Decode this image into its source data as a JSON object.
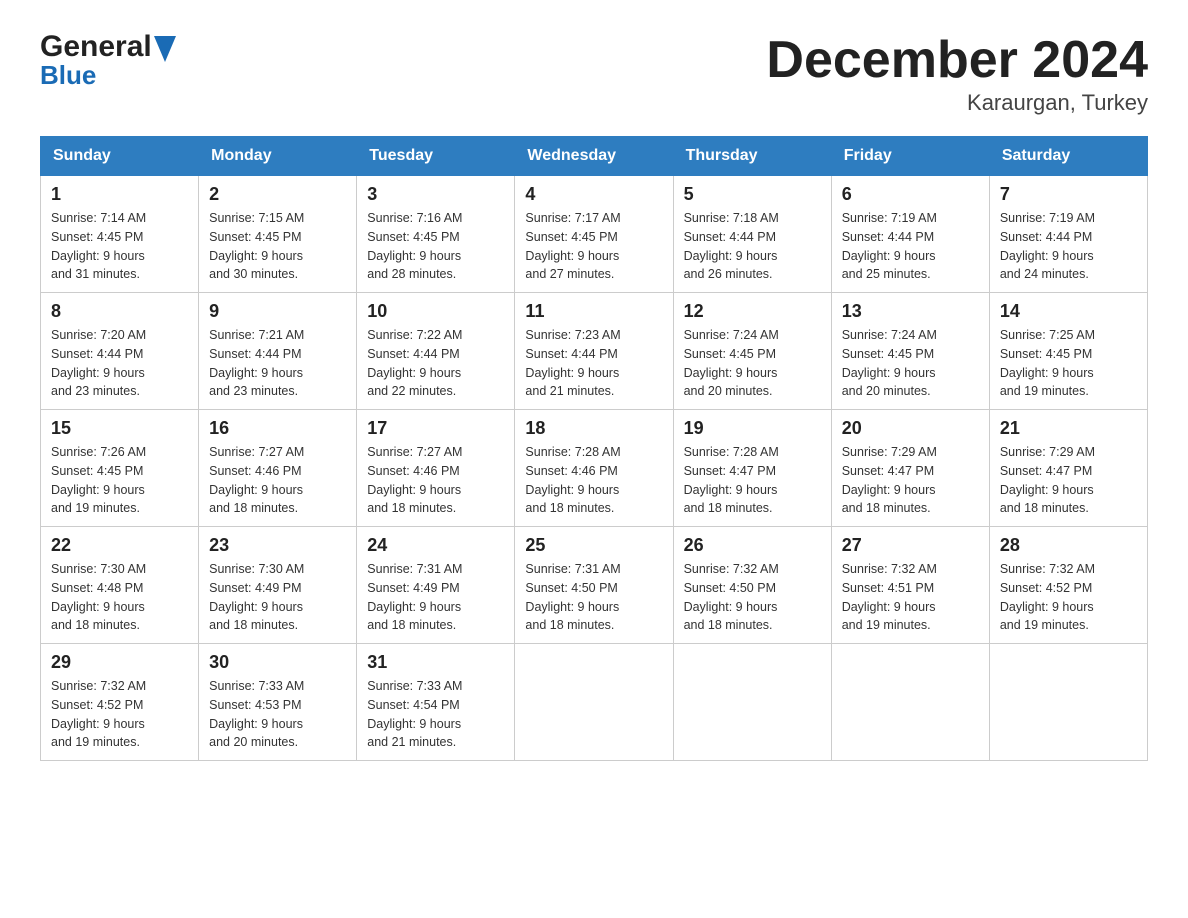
{
  "logo": {
    "general": "General",
    "blue": "Blue",
    "arrow_color": "#1a6bb5"
  },
  "title": "December 2024",
  "subtitle": "Karaurgan, Turkey",
  "days_of_week": [
    "Sunday",
    "Monday",
    "Tuesday",
    "Wednesday",
    "Thursday",
    "Friday",
    "Saturday"
  ],
  "weeks": [
    [
      {
        "day": "1",
        "sunrise": "7:14 AM",
        "sunset": "4:45 PM",
        "daylight": "9 hours and 31 minutes."
      },
      {
        "day": "2",
        "sunrise": "7:15 AM",
        "sunset": "4:45 PM",
        "daylight": "9 hours and 30 minutes."
      },
      {
        "day": "3",
        "sunrise": "7:16 AM",
        "sunset": "4:45 PM",
        "daylight": "9 hours and 28 minutes."
      },
      {
        "day": "4",
        "sunrise": "7:17 AM",
        "sunset": "4:45 PM",
        "daylight": "9 hours and 27 minutes."
      },
      {
        "day": "5",
        "sunrise": "7:18 AM",
        "sunset": "4:44 PM",
        "daylight": "9 hours and 26 minutes."
      },
      {
        "day": "6",
        "sunrise": "7:19 AM",
        "sunset": "4:44 PM",
        "daylight": "9 hours and 25 minutes."
      },
      {
        "day": "7",
        "sunrise": "7:19 AM",
        "sunset": "4:44 PM",
        "daylight": "9 hours and 24 minutes."
      }
    ],
    [
      {
        "day": "8",
        "sunrise": "7:20 AM",
        "sunset": "4:44 PM",
        "daylight": "9 hours and 23 minutes."
      },
      {
        "day": "9",
        "sunrise": "7:21 AM",
        "sunset": "4:44 PM",
        "daylight": "9 hours and 23 minutes."
      },
      {
        "day": "10",
        "sunrise": "7:22 AM",
        "sunset": "4:44 PM",
        "daylight": "9 hours and 22 minutes."
      },
      {
        "day": "11",
        "sunrise": "7:23 AM",
        "sunset": "4:44 PM",
        "daylight": "9 hours and 21 minutes."
      },
      {
        "day": "12",
        "sunrise": "7:24 AM",
        "sunset": "4:45 PM",
        "daylight": "9 hours and 20 minutes."
      },
      {
        "day": "13",
        "sunrise": "7:24 AM",
        "sunset": "4:45 PM",
        "daylight": "9 hours and 20 minutes."
      },
      {
        "day": "14",
        "sunrise": "7:25 AM",
        "sunset": "4:45 PM",
        "daylight": "9 hours and 19 minutes."
      }
    ],
    [
      {
        "day": "15",
        "sunrise": "7:26 AM",
        "sunset": "4:45 PM",
        "daylight": "9 hours and 19 minutes."
      },
      {
        "day": "16",
        "sunrise": "7:27 AM",
        "sunset": "4:46 PM",
        "daylight": "9 hours and 18 minutes."
      },
      {
        "day": "17",
        "sunrise": "7:27 AM",
        "sunset": "4:46 PM",
        "daylight": "9 hours and 18 minutes."
      },
      {
        "day": "18",
        "sunrise": "7:28 AM",
        "sunset": "4:46 PM",
        "daylight": "9 hours and 18 minutes."
      },
      {
        "day": "19",
        "sunrise": "7:28 AM",
        "sunset": "4:47 PM",
        "daylight": "9 hours and 18 minutes."
      },
      {
        "day": "20",
        "sunrise": "7:29 AM",
        "sunset": "4:47 PM",
        "daylight": "9 hours and 18 minutes."
      },
      {
        "day": "21",
        "sunrise": "7:29 AM",
        "sunset": "4:47 PM",
        "daylight": "9 hours and 18 minutes."
      }
    ],
    [
      {
        "day": "22",
        "sunrise": "7:30 AM",
        "sunset": "4:48 PM",
        "daylight": "9 hours and 18 minutes."
      },
      {
        "day": "23",
        "sunrise": "7:30 AM",
        "sunset": "4:49 PM",
        "daylight": "9 hours and 18 minutes."
      },
      {
        "day": "24",
        "sunrise": "7:31 AM",
        "sunset": "4:49 PM",
        "daylight": "9 hours and 18 minutes."
      },
      {
        "day": "25",
        "sunrise": "7:31 AM",
        "sunset": "4:50 PM",
        "daylight": "9 hours and 18 minutes."
      },
      {
        "day": "26",
        "sunrise": "7:32 AM",
        "sunset": "4:50 PM",
        "daylight": "9 hours and 18 minutes."
      },
      {
        "day": "27",
        "sunrise": "7:32 AM",
        "sunset": "4:51 PM",
        "daylight": "9 hours and 19 minutes."
      },
      {
        "day": "28",
        "sunrise": "7:32 AM",
        "sunset": "4:52 PM",
        "daylight": "9 hours and 19 minutes."
      }
    ],
    [
      {
        "day": "29",
        "sunrise": "7:32 AM",
        "sunset": "4:52 PM",
        "daylight": "9 hours and 19 minutes."
      },
      {
        "day": "30",
        "sunrise": "7:33 AM",
        "sunset": "4:53 PM",
        "daylight": "9 hours and 20 minutes."
      },
      {
        "day": "31",
        "sunrise": "7:33 AM",
        "sunset": "4:54 PM",
        "daylight": "9 hours and 21 minutes."
      },
      null,
      null,
      null,
      null
    ]
  ],
  "labels": {
    "sunrise": "Sunrise:",
    "sunset": "Sunset:",
    "daylight": "Daylight:"
  }
}
